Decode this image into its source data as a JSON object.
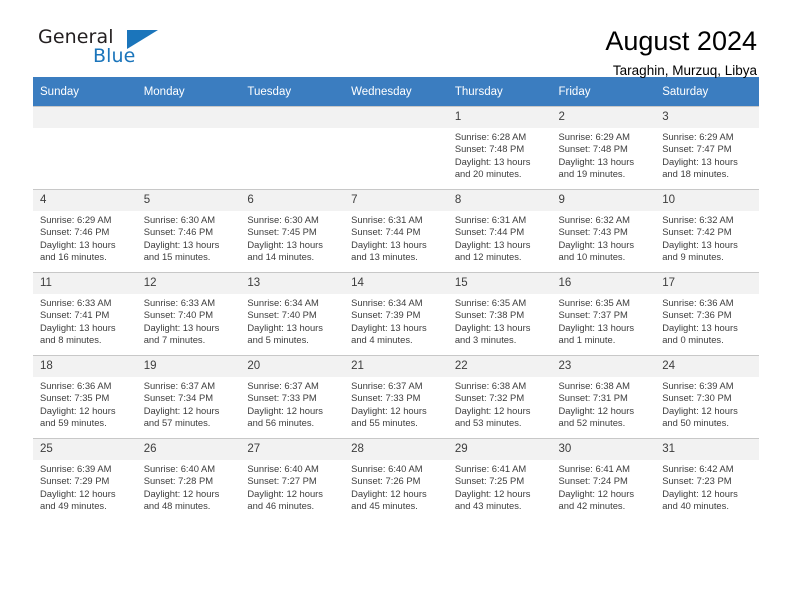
{
  "brand": {
    "name_top": "General",
    "name_bottom": "Blue",
    "accent_color": "#1b75bb"
  },
  "header": {
    "title": "August 2024",
    "subtitle": "Taraghin, Murzuq, Libya"
  },
  "theme": {
    "header_row_bg": "#3b7dc0",
    "header_row_text": "#ffffff",
    "daynum_bg": "#f2f2f2",
    "cell_border": "#c8c8c8",
    "body_text": "#3d3d3d"
  },
  "weekday_headers": [
    "Sunday",
    "Monday",
    "Tuesday",
    "Wednesday",
    "Thursday",
    "Friday",
    "Saturday"
  ],
  "weeks": [
    [
      {
        "day": "",
        "empty": true,
        "sunrise": "",
        "sunset": "",
        "daylight1": "",
        "daylight2": ""
      },
      {
        "day": "",
        "empty": true,
        "sunrise": "",
        "sunset": "",
        "daylight1": "",
        "daylight2": ""
      },
      {
        "day": "",
        "empty": true,
        "sunrise": "",
        "sunset": "",
        "daylight1": "",
        "daylight2": ""
      },
      {
        "day": "",
        "empty": true,
        "sunrise": "",
        "sunset": "",
        "daylight1": "",
        "daylight2": ""
      },
      {
        "day": "1",
        "empty": false,
        "sunrise": "Sunrise: 6:28 AM",
        "sunset": "Sunset: 7:48 PM",
        "daylight1": "Daylight: 13 hours",
        "daylight2": "and 20 minutes."
      },
      {
        "day": "2",
        "empty": false,
        "sunrise": "Sunrise: 6:29 AM",
        "sunset": "Sunset: 7:48 PM",
        "daylight1": "Daylight: 13 hours",
        "daylight2": "and 19 minutes."
      },
      {
        "day": "3",
        "empty": false,
        "sunrise": "Sunrise: 6:29 AM",
        "sunset": "Sunset: 7:47 PM",
        "daylight1": "Daylight: 13 hours",
        "daylight2": "and 18 minutes."
      }
    ],
    [
      {
        "day": "4",
        "empty": false,
        "sunrise": "Sunrise: 6:29 AM",
        "sunset": "Sunset: 7:46 PM",
        "daylight1": "Daylight: 13 hours",
        "daylight2": "and 16 minutes."
      },
      {
        "day": "5",
        "empty": false,
        "sunrise": "Sunrise: 6:30 AM",
        "sunset": "Sunset: 7:46 PM",
        "daylight1": "Daylight: 13 hours",
        "daylight2": "and 15 minutes."
      },
      {
        "day": "6",
        "empty": false,
        "sunrise": "Sunrise: 6:30 AM",
        "sunset": "Sunset: 7:45 PM",
        "daylight1": "Daylight: 13 hours",
        "daylight2": "and 14 minutes."
      },
      {
        "day": "7",
        "empty": false,
        "sunrise": "Sunrise: 6:31 AM",
        "sunset": "Sunset: 7:44 PM",
        "daylight1": "Daylight: 13 hours",
        "daylight2": "and 13 minutes."
      },
      {
        "day": "8",
        "empty": false,
        "sunrise": "Sunrise: 6:31 AM",
        "sunset": "Sunset: 7:44 PM",
        "daylight1": "Daylight: 13 hours",
        "daylight2": "and 12 minutes."
      },
      {
        "day": "9",
        "empty": false,
        "sunrise": "Sunrise: 6:32 AM",
        "sunset": "Sunset: 7:43 PM",
        "daylight1": "Daylight: 13 hours",
        "daylight2": "and 10 minutes."
      },
      {
        "day": "10",
        "empty": false,
        "sunrise": "Sunrise: 6:32 AM",
        "sunset": "Sunset: 7:42 PM",
        "daylight1": "Daylight: 13 hours",
        "daylight2": "and 9 minutes."
      }
    ],
    [
      {
        "day": "11",
        "empty": false,
        "sunrise": "Sunrise: 6:33 AM",
        "sunset": "Sunset: 7:41 PM",
        "daylight1": "Daylight: 13 hours",
        "daylight2": "and 8 minutes."
      },
      {
        "day": "12",
        "empty": false,
        "sunrise": "Sunrise: 6:33 AM",
        "sunset": "Sunset: 7:40 PM",
        "daylight1": "Daylight: 13 hours",
        "daylight2": "and 7 minutes."
      },
      {
        "day": "13",
        "empty": false,
        "sunrise": "Sunrise: 6:34 AM",
        "sunset": "Sunset: 7:40 PM",
        "daylight1": "Daylight: 13 hours",
        "daylight2": "and 5 minutes."
      },
      {
        "day": "14",
        "empty": false,
        "sunrise": "Sunrise: 6:34 AM",
        "sunset": "Sunset: 7:39 PM",
        "daylight1": "Daylight: 13 hours",
        "daylight2": "and 4 minutes."
      },
      {
        "day": "15",
        "empty": false,
        "sunrise": "Sunrise: 6:35 AM",
        "sunset": "Sunset: 7:38 PM",
        "daylight1": "Daylight: 13 hours",
        "daylight2": "and 3 minutes."
      },
      {
        "day": "16",
        "empty": false,
        "sunrise": "Sunrise: 6:35 AM",
        "sunset": "Sunset: 7:37 PM",
        "daylight1": "Daylight: 13 hours",
        "daylight2": "and 1 minute."
      },
      {
        "day": "17",
        "empty": false,
        "sunrise": "Sunrise: 6:36 AM",
        "sunset": "Sunset: 7:36 PM",
        "daylight1": "Daylight: 13 hours",
        "daylight2": "and 0 minutes."
      }
    ],
    [
      {
        "day": "18",
        "empty": false,
        "sunrise": "Sunrise: 6:36 AM",
        "sunset": "Sunset: 7:35 PM",
        "daylight1": "Daylight: 12 hours",
        "daylight2": "and 59 minutes."
      },
      {
        "day": "19",
        "empty": false,
        "sunrise": "Sunrise: 6:37 AM",
        "sunset": "Sunset: 7:34 PM",
        "daylight1": "Daylight: 12 hours",
        "daylight2": "and 57 minutes."
      },
      {
        "day": "20",
        "empty": false,
        "sunrise": "Sunrise: 6:37 AM",
        "sunset": "Sunset: 7:33 PM",
        "daylight1": "Daylight: 12 hours",
        "daylight2": "and 56 minutes."
      },
      {
        "day": "21",
        "empty": false,
        "sunrise": "Sunrise: 6:37 AM",
        "sunset": "Sunset: 7:33 PM",
        "daylight1": "Daylight: 12 hours",
        "daylight2": "and 55 minutes."
      },
      {
        "day": "22",
        "empty": false,
        "sunrise": "Sunrise: 6:38 AM",
        "sunset": "Sunset: 7:32 PM",
        "daylight1": "Daylight: 12 hours",
        "daylight2": "and 53 minutes."
      },
      {
        "day": "23",
        "empty": false,
        "sunrise": "Sunrise: 6:38 AM",
        "sunset": "Sunset: 7:31 PM",
        "daylight1": "Daylight: 12 hours",
        "daylight2": "and 52 minutes."
      },
      {
        "day": "24",
        "empty": false,
        "sunrise": "Sunrise: 6:39 AM",
        "sunset": "Sunset: 7:30 PM",
        "daylight1": "Daylight: 12 hours",
        "daylight2": "and 50 minutes."
      }
    ],
    [
      {
        "day": "25",
        "empty": false,
        "sunrise": "Sunrise: 6:39 AM",
        "sunset": "Sunset: 7:29 PM",
        "daylight1": "Daylight: 12 hours",
        "daylight2": "and 49 minutes."
      },
      {
        "day": "26",
        "empty": false,
        "sunrise": "Sunrise: 6:40 AM",
        "sunset": "Sunset: 7:28 PM",
        "daylight1": "Daylight: 12 hours",
        "daylight2": "and 48 minutes."
      },
      {
        "day": "27",
        "empty": false,
        "sunrise": "Sunrise: 6:40 AM",
        "sunset": "Sunset: 7:27 PM",
        "daylight1": "Daylight: 12 hours",
        "daylight2": "and 46 minutes."
      },
      {
        "day": "28",
        "empty": false,
        "sunrise": "Sunrise: 6:40 AM",
        "sunset": "Sunset: 7:26 PM",
        "daylight1": "Daylight: 12 hours",
        "daylight2": "and 45 minutes."
      },
      {
        "day": "29",
        "empty": false,
        "sunrise": "Sunrise: 6:41 AM",
        "sunset": "Sunset: 7:25 PM",
        "daylight1": "Daylight: 12 hours",
        "daylight2": "and 43 minutes."
      },
      {
        "day": "30",
        "empty": false,
        "sunrise": "Sunrise: 6:41 AM",
        "sunset": "Sunset: 7:24 PM",
        "daylight1": "Daylight: 12 hours",
        "daylight2": "and 42 minutes."
      },
      {
        "day": "31",
        "empty": false,
        "sunrise": "Sunrise: 6:42 AM",
        "sunset": "Sunset: 7:23 PM",
        "daylight1": "Daylight: 12 hours",
        "daylight2": "and 40 minutes."
      }
    ]
  ]
}
